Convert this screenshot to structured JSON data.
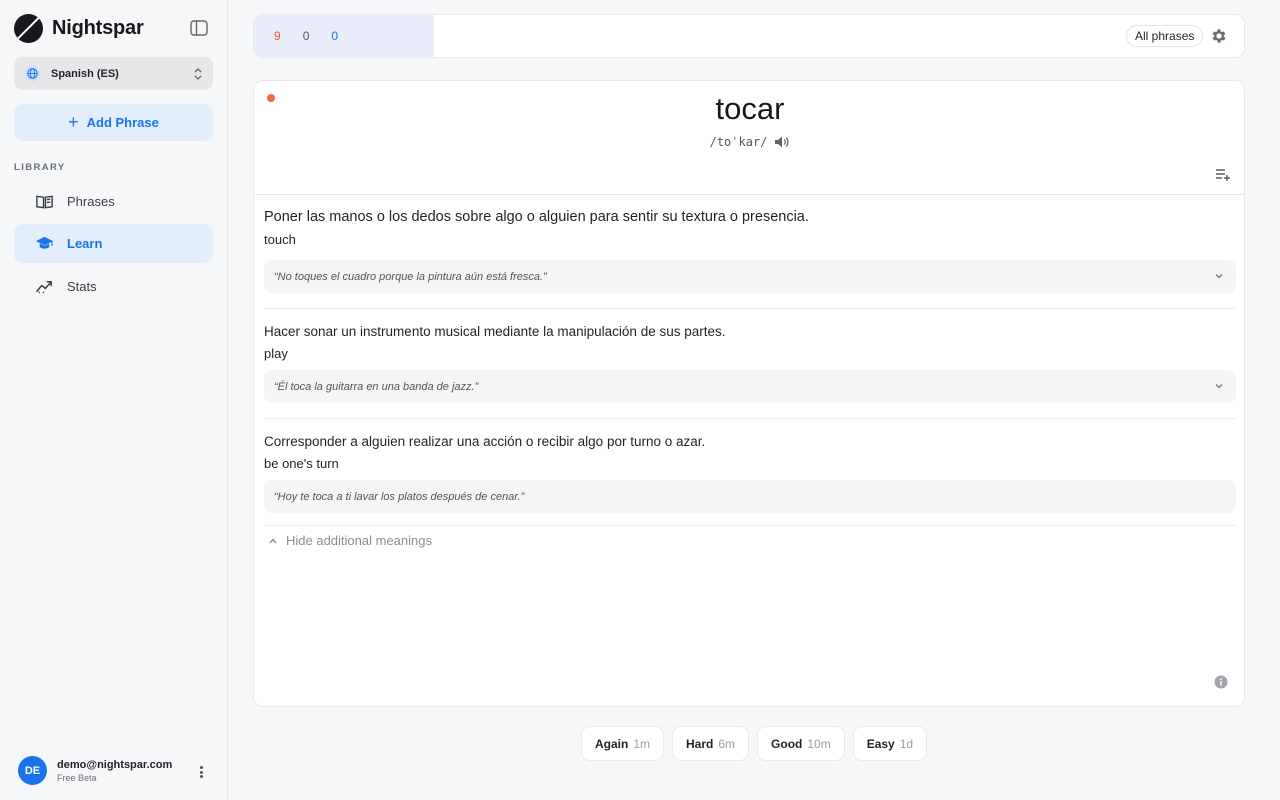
{
  "app": {
    "name": "Nightspar"
  },
  "sidebar": {
    "language": "Spanish (ES)",
    "add_label": "Add Phrase",
    "section_label": "LIBRARY",
    "items": [
      {
        "label": "Phrases",
        "icon": "book-icon"
      },
      {
        "label": "Learn",
        "icon": "graduation-cap-icon",
        "active": true
      },
      {
        "label": "Stats",
        "icon": "trend-chart-icon"
      }
    ],
    "user": {
      "initials": "DE",
      "email": "demo@nightspar.com",
      "plan": "Free Beta"
    }
  },
  "topbar": {
    "counts": {
      "new": "9",
      "learning": "0",
      "review": "0"
    },
    "filter": "All phrases"
  },
  "card": {
    "word": "tocar",
    "pronunciation": "/toˈkar/",
    "meanings": [
      {
        "definition": "Poner las manos o los dedos sobre algo o alguien para sentir su textura o presencia.",
        "translation": "touch",
        "example": "“No toques el cuadro porque la pintura aún está fresca.”"
      },
      {
        "definition": "Hacer sonar un instrumento musical mediante la manipulación de sus partes.",
        "translation": "play",
        "example": "“Él toca la guitarra en una banda de jazz.”"
      },
      {
        "definition": "Corresponder a alguien realizar una acción o recibir algo por turno o azar.",
        "translation": "be one's turn",
        "example": "“Hoy te toca a ti lavar los platos después de cenar.”"
      }
    ],
    "hide_label": "Hide additional meanings"
  },
  "rating": [
    {
      "label": "Again",
      "interval": "1m"
    },
    {
      "label": "Hard",
      "interval": "6m"
    },
    {
      "label": "Good",
      "interval": "10m"
    },
    {
      "label": "Easy",
      "interval": "1d"
    }
  ],
  "colors": {
    "accent": "#1a73e8",
    "new": "#e5533d",
    "dot": "#ef6b4f"
  }
}
